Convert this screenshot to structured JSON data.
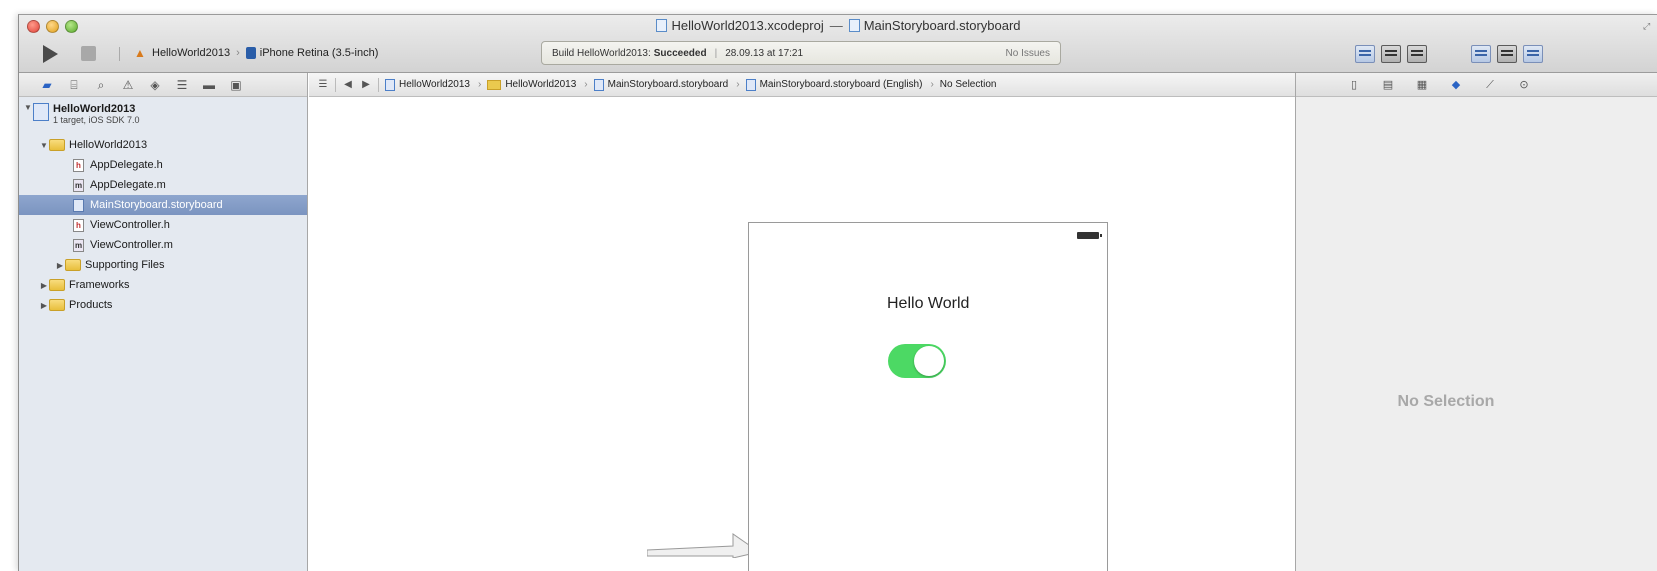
{
  "window": {
    "title_project": "HelloWorld2013.xcodeproj",
    "title_separator": "—",
    "title_file": "MainStoryboard.storyboard"
  },
  "toolbar": {
    "scheme_app": "HelloWorld2013",
    "scheme_device": "iPhone Retina (3.5-inch)",
    "activity": {
      "prefix": "Build HelloWorld2013:",
      "status": "Succeeded",
      "timestamp": "28.09.13 at 17:21",
      "issues": "No Issues"
    }
  },
  "navigator": {
    "project": {
      "name": "HelloWorld2013",
      "subtitle": "1 target, iOS SDK 7.0"
    },
    "group": "HelloWorld2013",
    "files": [
      {
        "label": "AppDelegate.h",
        "kind": "h"
      },
      {
        "label": "AppDelegate.m",
        "kind": "m"
      },
      {
        "label": "MainStoryboard.storyboard",
        "kind": "storyboard",
        "selected": true
      },
      {
        "label": "ViewController.h",
        "kind": "h"
      },
      {
        "label": "ViewController.m",
        "kind": "m"
      }
    ],
    "supporting_files": "Supporting Files",
    "frameworks": "Frameworks",
    "products": "Products"
  },
  "jumpbar": {
    "crumbs": [
      "HelloWorld2013",
      "HelloWorld2013",
      "MainStoryboard.storyboard",
      "MainStoryboard.storyboard (English)",
      "No Selection"
    ]
  },
  "canvas": {
    "label_text": "Hello World",
    "switch_on": true,
    "switch_color": "#4cd964"
  },
  "utilities": {
    "empty_message": "No Selection"
  },
  "icons": {
    "traffic_lights": [
      "close-icon",
      "minimize-icon",
      "zoom-icon"
    ],
    "toolbar": [
      "run-icon",
      "stop-icon"
    ],
    "navigator_tabs": [
      "project-navigator-icon",
      "symbol-navigator-icon",
      "search-navigator-icon",
      "issue-navigator-icon",
      "test-navigator-icon",
      "debug-navigator-icon",
      "breakpoint-navigator-icon",
      "log-navigator-icon"
    ],
    "inspector_tabs": [
      "file-inspector-icon",
      "quick-help-icon",
      "identity-inspector-icon",
      "attributes-inspector-icon",
      "size-inspector-icon",
      "connections-inspector-icon"
    ]
  }
}
